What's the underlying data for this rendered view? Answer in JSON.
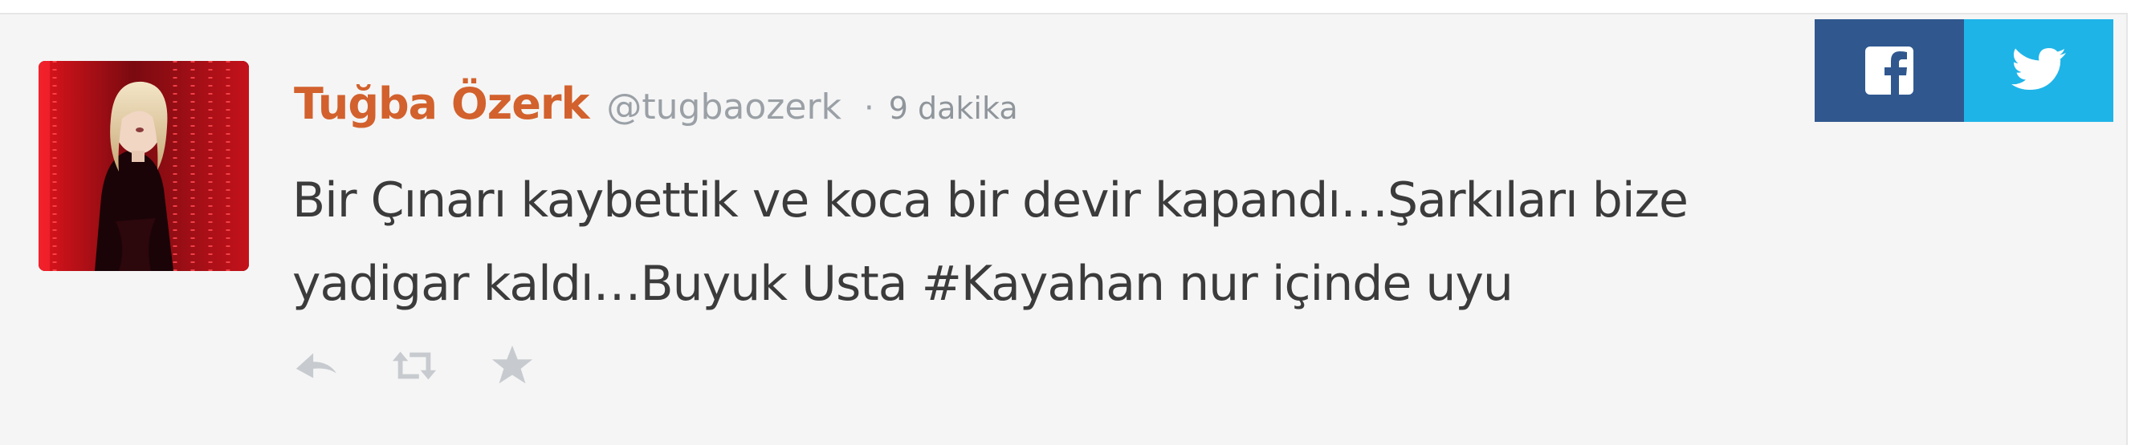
{
  "tweet": {
    "author_name": "Tuğba Özerk",
    "author_handle": "@tugbaozerk",
    "separator": "·",
    "timestamp": "9 dakika",
    "text_line1": "Bir Çınarı kaybettik ve koca bir devir kapandı…Şarkıları bize",
    "text_line2": "yadigar kaldı…Buyuk Usta #Kayahan nur içinde uyu"
  },
  "actions": [
    {
      "icon": "reply-icon"
    },
    {
      "icon": "retweet-icon"
    },
    {
      "icon": "favorite-star-icon"
    }
  ],
  "share": {
    "facebook_icon": "facebook-icon",
    "twitter_icon": "twitter-icon"
  },
  "colors": {
    "card_background": "#f5f5f5",
    "author_name": "#d2612d",
    "muted_text": "#9aa0a6",
    "tweet_text": "#3b3b3b",
    "action_icons": "#c7cbcf",
    "facebook": "#30588f",
    "twitter": "#1fb4e8"
  }
}
